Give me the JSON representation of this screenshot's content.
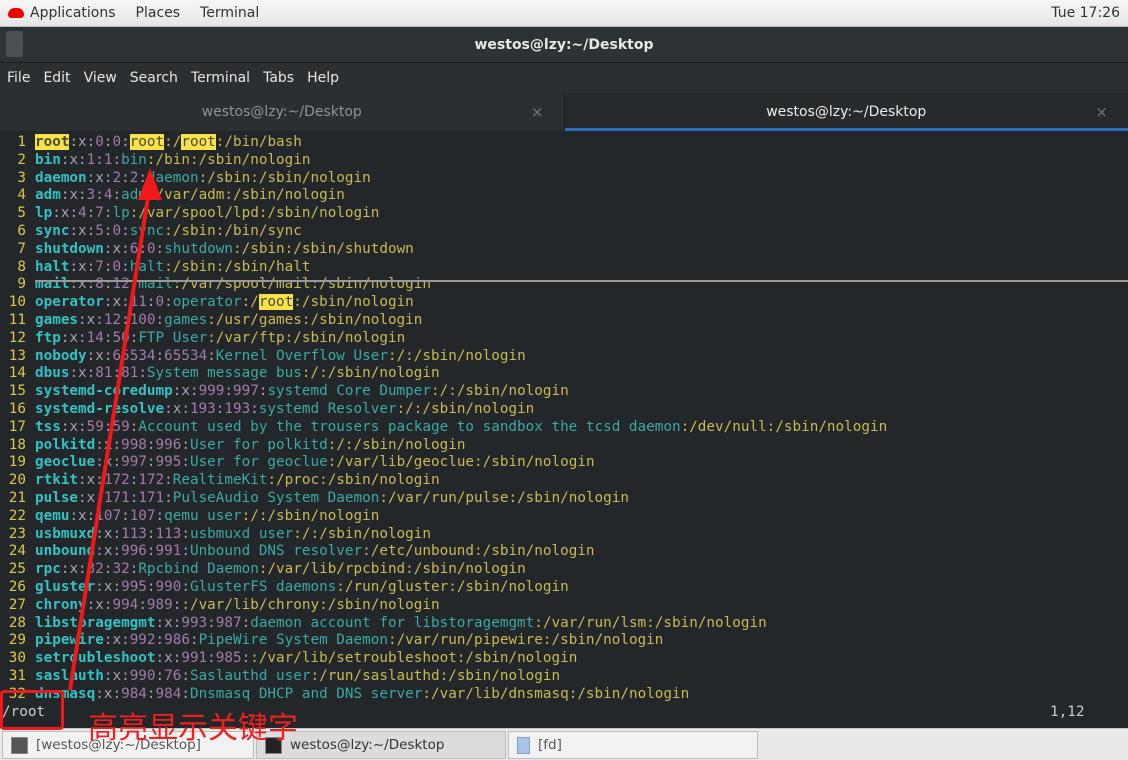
{
  "topbar": {
    "applications": "Applications",
    "places": "Places",
    "terminal": "Terminal",
    "clock": "Tue 17:26"
  },
  "window": {
    "title": "westos@lzy:~/Desktop"
  },
  "menu": [
    "File",
    "Edit",
    "View",
    "Search",
    "Terminal",
    "Tabs",
    "Help"
  ],
  "tabs": [
    {
      "label": "westos@lzy:~/Desktop",
      "active": false
    },
    {
      "label": "westos@lzy:~/Desktop",
      "active": true
    }
  ],
  "terminal": {
    "search_term": "root",
    "lines": [
      "root:x:0:0:root:/root:/bin/bash",
      "bin:x:1:1:bin:/bin:/sbin/nologin",
      "daemon:x:2:2:daemon:/sbin:/sbin/nologin",
      "adm:x:3:4:adm:/var/adm:/sbin/nologin",
      "lp:x:4:7:lp:/var/spool/lpd:/sbin/nologin",
      "sync:x:5:0:sync:/sbin:/bin/sync",
      "shutdown:x:6:0:shutdown:/sbin:/sbin/shutdown",
      "halt:x:7:0:halt:/sbin:/sbin/halt",
      "mail:x:8:12:mail:/var/spool/mail:/sbin/nologin",
      "operator:x:11:0:operator:/root:/sbin/nologin",
      "games:x:12:100:games:/usr/games:/sbin/nologin",
      "ftp:x:14:50:FTP User:/var/ftp:/sbin/nologin",
      "nobody:x:65534:65534:Kernel Overflow User:/:/sbin/nologin",
      "dbus:x:81:81:System message bus:/:/sbin/nologin",
      "systemd-coredump:x:999:997:systemd Core Dumper:/:/sbin/nologin",
      "systemd-resolve:x:193:193:systemd Resolver:/:/sbin/nologin",
      "tss:x:59:59:Account used by the trousers package to sandbox the tcsd daemon:/dev/null:/sbin/nologin",
      "polkitd:x:998:996:User for polkitd:/:/sbin/nologin",
      "geoclue:x:997:995:User for geoclue:/var/lib/geoclue:/sbin/nologin",
      "rtkit:x:172:172:RealtimeKit:/proc:/sbin/nologin",
      "pulse:x:171:171:PulseAudio System Daemon:/var/run/pulse:/sbin/nologin",
      "qemu:x:107:107:qemu user:/:/sbin/nologin",
      "usbmuxd:x:113:113:usbmuxd user:/:/sbin/nologin",
      "unbound:x:996:991:Unbound DNS resolver:/etc/unbound:/sbin/nologin",
      "rpc:x:32:32:Rpcbind Daemon:/var/lib/rpcbind:/sbin/nologin",
      "gluster:x:995:990:GlusterFS daemons:/run/gluster:/sbin/nologin",
      "chrony:x:994:989::/var/lib/chrony:/sbin/nologin",
      "libstoragemgmt:x:993:987:daemon account for libstoragemgmt:/var/run/lsm:/sbin/nologin",
      "pipewire:x:992:986:PipeWire System Daemon:/var/run/pipewire:/sbin/nologin",
      "setroubleshoot:x:991:985::/var/lib/setroubleshoot:/sbin/nologin",
      "saslauth:x:990:76:Saslauthd user:/run/saslauthd:/sbin/nologin",
      "dnsmasq:x:984:984:Dnsmasq DHCP and DNS server:/var/lib/dnsmasq:/sbin/nologin"
    ],
    "command": "/root",
    "cursor_position": "1,12"
  },
  "annotation": "高亮显示关键字",
  "taskbar": [
    {
      "label": "[westos@lzy:~/Desktop]"
    },
    {
      "label": "westos@lzy:~/Desktop"
    },
    {
      "label": "[fd]"
    }
  ],
  "colors": {
    "highlight": "#f7e24a",
    "annotation": "#f02020",
    "tab_accent": "#2d6fbf"
  }
}
